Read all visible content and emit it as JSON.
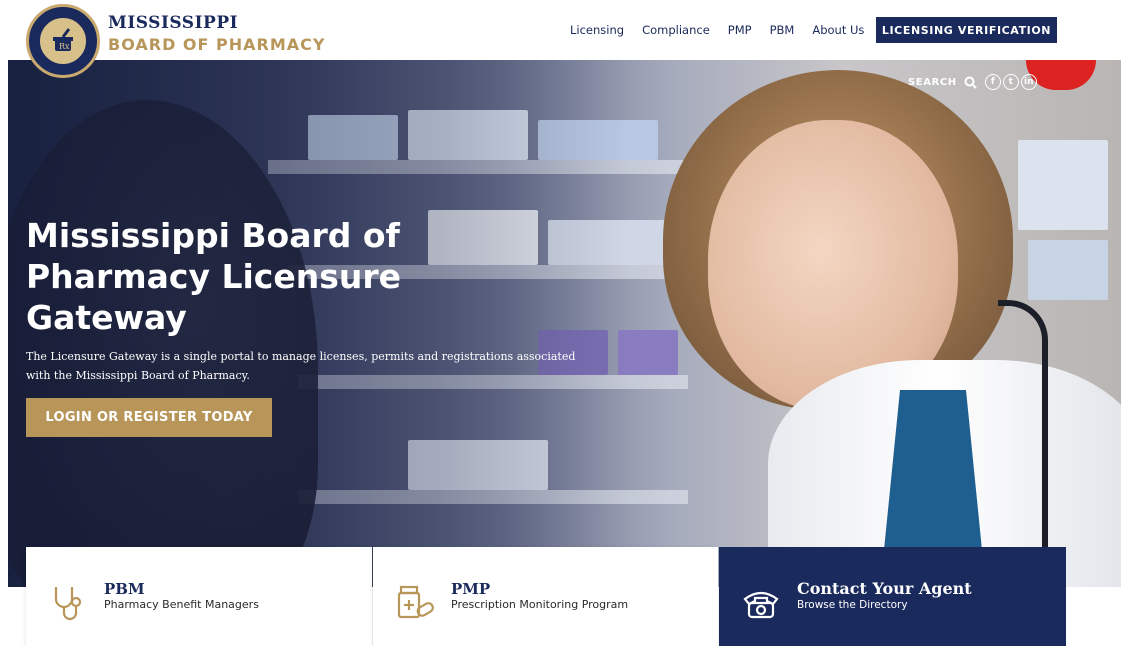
{
  "header": {
    "brand_top": "MISSISSIPPI",
    "brand_bottom": "BOARD OF PHARMACY",
    "nav": [
      "Licensing",
      "Compliance",
      "PMP",
      "PBM",
      "About Us"
    ],
    "cta_label": "LICENSING VERIFICATION"
  },
  "utility": {
    "search_label": "SEARCH",
    "social": [
      "facebook-icon",
      "twitter-icon",
      "linkedin-icon"
    ]
  },
  "hero": {
    "title": "Mississippi Board of Pharmacy Licensure Gateway",
    "subtitle": "The Licensure Gateway is a single portal to manage licenses, permits and registrations associated with the Mississippi Board of Pharmacy.",
    "cta_label": "LOGIN OR REGISTER TODAY"
  },
  "cards": [
    {
      "title": "PBM",
      "subtitle": "Pharmacy Benefit Managers",
      "icon": "stethoscope-icon"
    },
    {
      "title": "PMP",
      "subtitle": "Prescription Monitoring Program",
      "icon": "pill-bottle-icon"
    },
    {
      "title": "Contact Your Agent",
      "subtitle": "Browse the Directory",
      "icon": "telephone-icon"
    }
  ],
  "colors": {
    "navy": "#1b2a5c",
    "gold": "#b8965a",
    "white": "#ffffff"
  }
}
